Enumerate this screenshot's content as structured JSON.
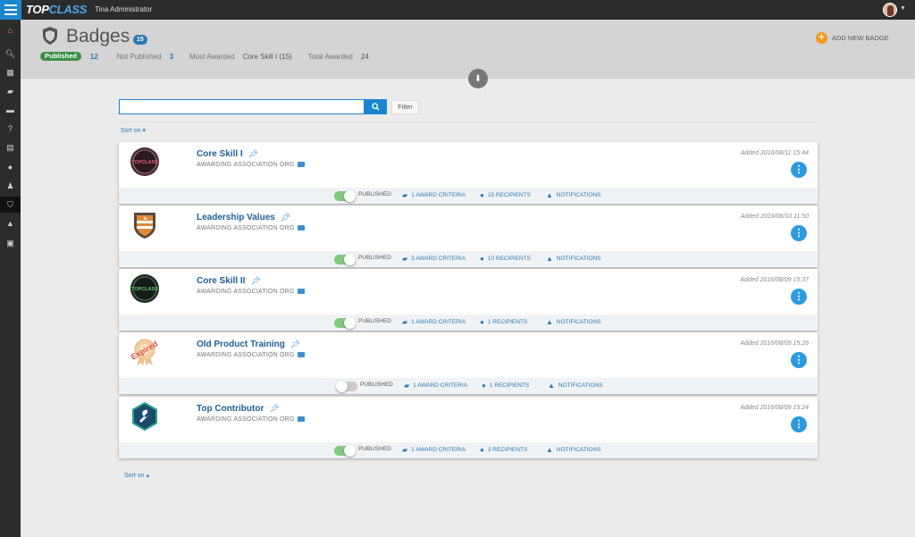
{
  "app": {
    "brand_a": "TOP",
    "brand_b": "CLASS",
    "user": "Tina Administrator"
  },
  "header": {
    "title": "Badges",
    "count": "15",
    "published_label": "Published",
    "published_count": "12",
    "not_published_label": "Not Published",
    "not_published_count": "3",
    "most_awarded_label": "Most Awarded",
    "most_awarded_value": "Core Skill I (15)",
    "total_awarded_label": "Total Awarded",
    "total_awarded_value": "24",
    "add_label": "ADD NEW BADGE"
  },
  "search": {
    "value": "",
    "placeholder": "",
    "filter_label": "Filter"
  },
  "sort_label": "Sort on",
  "badges": [
    {
      "name": "Core Skill I",
      "org": "AWARDING ASSOCIATION ORG",
      "added": "Added 2016/08/11 15:44",
      "status": "PUBLISHED",
      "published": true,
      "criteria": "1 AWARD CRITERIA",
      "recipients": "15 RECIPIENTS",
      "notifications": "NOTIFICATIONS",
      "image_icon": "topclass-dark-badge-icon"
    },
    {
      "name": "Leadership Values",
      "org": "AWARDING ASSOCIATION ORG",
      "added": "Added 2016/08/10 11:50",
      "status": "PUBLISHED",
      "published": true,
      "criteria": "3 AWARD CRITERIA",
      "recipients": "10 RECIPIENTS",
      "notifications": "NOTIFICATIONS",
      "image_icon": "shield-stripes-badge-icon"
    },
    {
      "name": "Core Skill II",
      "org": "AWARDING ASSOCIATION ORG",
      "added": "Added 2016/08/09 15:37",
      "status": "PUBLISHED",
      "published": true,
      "criteria": "1 AWARD CRITERIA",
      "recipients": "1 RECIPIENTS",
      "notifications": "NOTIFICATIONS",
      "image_icon": "topclass-green-badge-icon"
    },
    {
      "name": "Old Product Training",
      "org": "AWARDING ASSOCIATION ORG",
      "added": "Added 2016/08/09 15:26",
      "status": "PUBLISHED",
      "published": false,
      "criteria": "1 AWARD CRITERIA",
      "recipients": "1 RECIPIENTS",
      "notifications": "NOTIFICATIONS",
      "image_icon": "expired-badge-icon",
      "overlay": "Expired"
    },
    {
      "name": "Top Contributor",
      "org": "AWARDING ASSOCIATION ORG",
      "added": "Added 2016/08/09 15:24",
      "status": "PUBLISHED",
      "published": true,
      "criteria": "1 AWARD CRITERIA",
      "recipients": "3 RECIPIENTS",
      "notifications": "NOTIFICATIONS",
      "image_icon": "wrench-hexagon-badge-icon"
    }
  ],
  "colors": {
    "accent": "#1a86d0",
    "title": "#1d5f96",
    "published": "#3b8f43",
    "add": "#f29a1c"
  }
}
